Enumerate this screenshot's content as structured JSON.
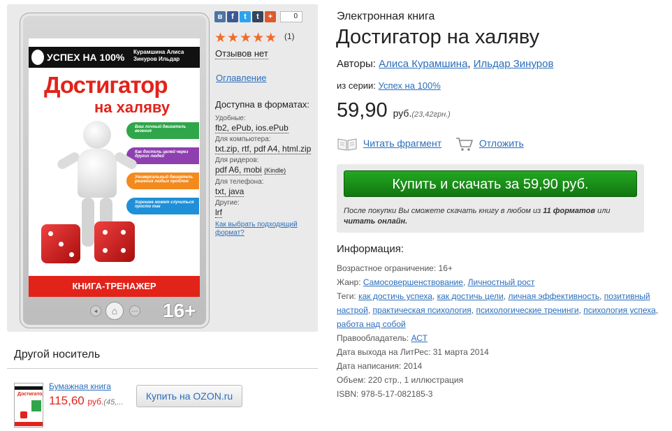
{
  "cover": {
    "series": "УСПЕХ НА 100%",
    "authors_line1": "Курамшина Алиса",
    "authors_line2": "Зинуров Ильдар",
    "title_line1": "Достигатор",
    "title_line2": "на халяву",
    "bars": [
      {
        "text": "Ваш личный двигатель везения",
        "color": "#2fa64a"
      },
      {
        "text": "Как достичь целей через других людей",
        "color": "#8e3fb0"
      },
      {
        "text": "Универсальный двигатель решения любых проблем",
        "color": "#f28a1e"
      },
      {
        "text": "Хорошее может случиться просто так",
        "color": "#1f8fd8"
      }
    ],
    "bottom_label": "КНИГА-ТРЕНАЖЕР",
    "age_badge": "16+"
  },
  "social": {
    "icons": [
      {
        "name": "vk-icon",
        "glyph": "в",
        "color": "#4c75a3"
      },
      {
        "name": "facebook-icon",
        "glyph": "f",
        "color": "#3b5998"
      },
      {
        "name": "twitter-icon",
        "glyph": "t",
        "color": "#2aa3ef"
      },
      {
        "name": "tumblr-icon",
        "glyph": "t",
        "color": "#35465c"
      },
      {
        "name": "google-plus-icon",
        "glyph": "+",
        "color": "#e0592b"
      }
    ],
    "count": "0"
  },
  "rating": {
    "stars": "★★★★★",
    "count": "(1)"
  },
  "reviews_label": "Отзывов нет",
  "toc_label": "Оглавление",
  "formats": {
    "heading": "Доступна в форматах:",
    "groups": [
      {
        "label": "Удобные:",
        "value": "fb2, ePub, ios.ePub"
      },
      {
        "label": "Для компьютера:",
        "value": "txt.zip, rtf, pdf A4, html.zip"
      },
      {
        "label": "Для ридеров:",
        "value": "pdf A6, mobi",
        "extra": "(Kindle)"
      },
      {
        "label": "Для телефона:",
        "value": "txt, java"
      },
      {
        "label": "Другие:",
        "value": "lrf"
      }
    ],
    "how_to_choose": "Как выбрать подходящий формат?"
  },
  "other_carrier": {
    "heading": "Другой носитель",
    "paper_label": "Бумажная книга",
    "price": "115,60",
    "currency": "руб.",
    "grn": "(45,...",
    "ozon_button": "Купить на OZON.ru"
  },
  "book": {
    "kind": "Электронная книга",
    "title": "Достигатор на халяву",
    "authors_label": "Авторы:",
    "authors": [
      "Алиса Курамшина",
      "Ильдар Зинуров"
    ],
    "series_label": "из серии:",
    "series": "Успех на 100%",
    "price": "59,90",
    "currency": "руб.",
    "grn": "(23,42грн.)",
    "read_fragment": "Читать фрагмент",
    "postpone": "Отложить",
    "buy_button": "Купить и скачать за 59,90 руб.",
    "buy_note_part1": "После покупки Вы сможете скачать книгу в любом из ",
    "buy_note_formats": "11 форматов",
    "buy_note_part2": " или ",
    "buy_note_read": "читать онлайн."
  },
  "info": {
    "heading": "Информация:",
    "age_label": "Возрастное ограничение:",
    "age": "16+",
    "genre_label": "Жанр:",
    "genres": [
      "Самосовершенствование",
      "Личностный рост"
    ],
    "tags_label": "Теги:",
    "tags": [
      "как достичь успеха",
      "как достичь цели",
      "личная эффективность",
      "позитивный настрой",
      "практическая психология",
      "психологические тренинги",
      "психология успеха",
      "работа над собой"
    ],
    "rights_label": "Правообладатель:",
    "rights": "АСТ",
    "release_label": "Дата выхода на ЛитРес:",
    "release": "31 марта 2014",
    "written_label": "Дата написания:",
    "written": "2014",
    "volume_label": "Объем:",
    "volume": "220 стр., 1 иллюстрация",
    "isbn_label": "ISBN:",
    "isbn": "978-5-17-082185-3"
  },
  "colors": {
    "link": "#2a6ebb",
    "buy_green": "#1a8f18",
    "price_red": "#e2231a",
    "star_orange": "#f26b2a"
  }
}
